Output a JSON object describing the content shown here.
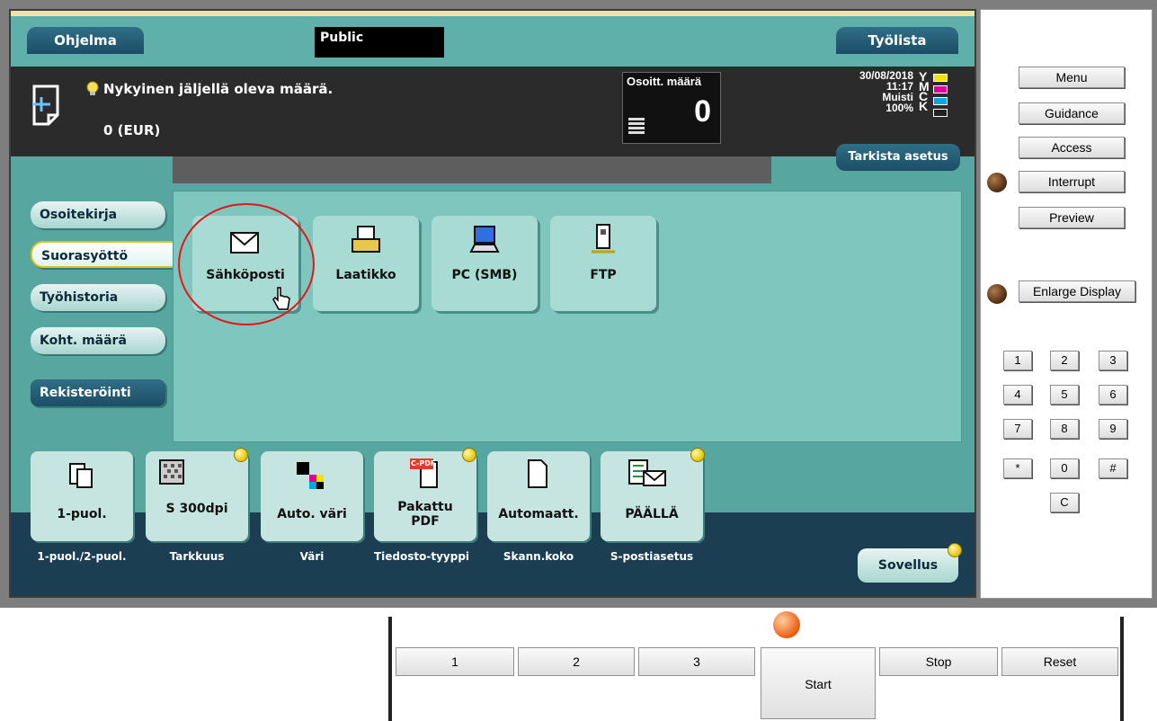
{
  "top_tabs": {
    "ohjelma": "Ohjelma",
    "public": "Public",
    "tyolista": "Työlista"
  },
  "info": {
    "remaining_label": "Nykyinen jäljellä oleva määrä.",
    "remaining_value": "0 (EUR)",
    "address_count_label": "Osoitt. määrä",
    "address_count_value": "0",
    "date": "30/08/2018",
    "time": "11:17",
    "memory_label": "Muisti",
    "memory_value": "100%",
    "toner": [
      "Y",
      "M",
      "C",
      "K"
    ],
    "toner_colors": [
      "#f2e100",
      "#e0009a",
      "#00a8e0",
      "#222222"
    ]
  },
  "check_settings": "Tarkista asetus",
  "side_buttons": [
    "Osoitekirja",
    "Suorasyöttö",
    "Työhistoria",
    "Koht. määrä",
    "Rekisteröinti"
  ],
  "destinations": [
    {
      "label": "Sähköposti",
      "icon": "envelope-icon"
    },
    {
      "label": "Laatikko",
      "icon": "box-icon"
    },
    {
      "label": "PC (SMB)",
      "icon": "pc-icon"
    },
    {
      "label": "FTP",
      "icon": "ftp-server-icon"
    }
  ],
  "settings": [
    {
      "value": "1-puol.",
      "label": "1-puol./2-puol."
    },
    {
      "value": "S 300dpi",
      "label": "Tarkkuus"
    },
    {
      "value": "Auto. väri",
      "label": "Väri"
    },
    {
      "value": "Pakattu PDF",
      "label": "Tiedosto-tyyppi"
    },
    {
      "value": "Automaatt.",
      "label": "Skann.koko"
    },
    {
      "value": "PÄÄLLÄ",
      "label": "S-postiasetus"
    }
  ],
  "sovellus": "Sovellus",
  "pdf_badge": "C-PDF",
  "right_panel": {
    "menu": "Menu",
    "guidance": "Guidance",
    "access": "Access",
    "interrupt": "Interrupt",
    "preview": "Preview",
    "enlarge": "Enlarge Display",
    "keypad": [
      "1",
      "2",
      "3",
      "4",
      "5",
      "6",
      "7",
      "8",
      "9",
      "*",
      "0",
      "#"
    ],
    "clear": "C"
  },
  "bottom_bar": {
    "b1": "1",
    "b2": "2",
    "b3": "3",
    "start": "Start",
    "stop": "Stop",
    "reset": "Reset"
  }
}
